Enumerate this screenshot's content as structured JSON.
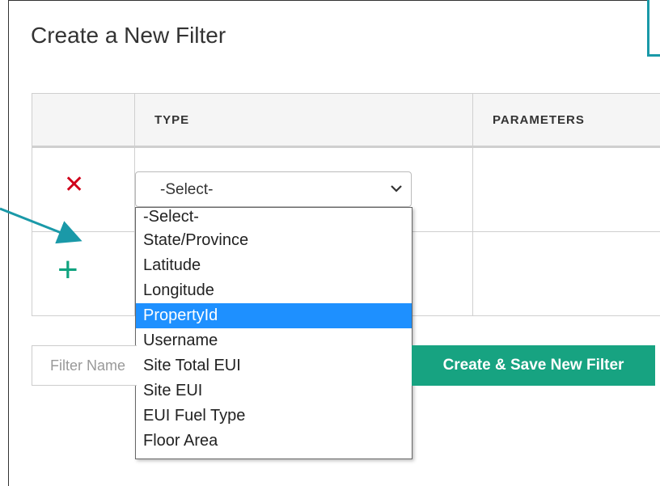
{
  "page": {
    "title": "Create a New Filter"
  },
  "table": {
    "headers": [
      "",
      "TYPE",
      "PARAMETERS"
    ]
  },
  "type_select": {
    "selected": "-Select-",
    "options": [
      "-Select-",
      "State/Province",
      "Latitude",
      "Longitude",
      "PropertyId",
      "Username",
      "Site Total EUI",
      "Site EUI",
      "EUI Fuel Type",
      "Floor Area"
    ],
    "highlighted_index": 4
  },
  "icons": {
    "remove": "close-icon",
    "add": "plus-icon",
    "remove_color": "#d0021b",
    "add_color": "#10a37f"
  },
  "filter_name": {
    "placeholder": "Filter Name"
  },
  "create_button": {
    "label": "Create & Save New Filter",
    "color": "#17a381"
  },
  "annotation": {
    "arrow_color": "#1a99a8"
  }
}
